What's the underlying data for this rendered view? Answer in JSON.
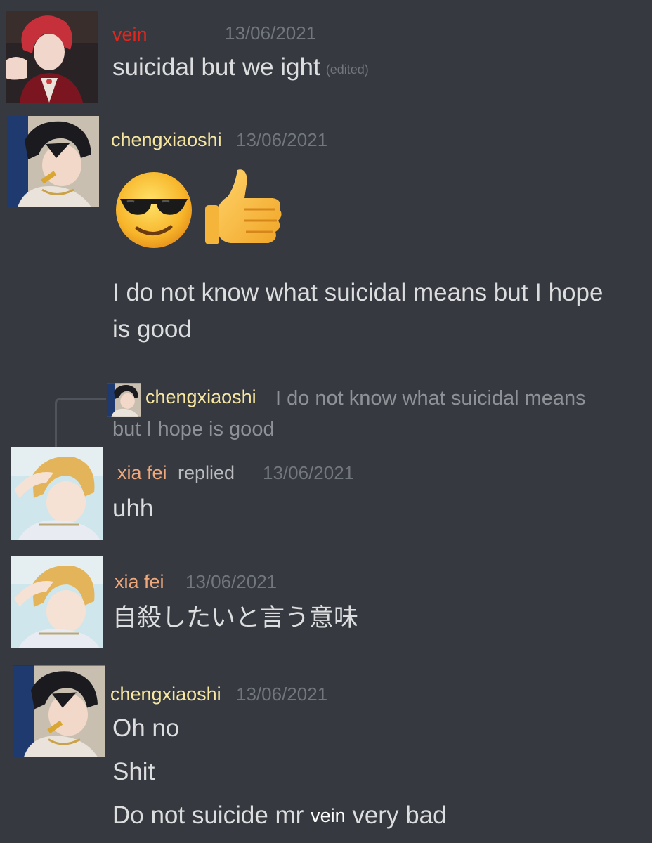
{
  "messages": [
    {
      "username": "vein",
      "username_color": "#e3261d",
      "timestamp": "13/06/2021",
      "lines": [
        "suicidal but we ight"
      ],
      "edited_label": "(edited)"
    },
    {
      "username": "chengxiaoshi",
      "username_color": "#f7e7a1",
      "timestamp": "13/06/2021",
      "emoji": [
        "smiling-face-with-sunglasses",
        "thumbs-up"
      ],
      "lines": [
        "I do not know what suicidal means but I hope",
        "is good"
      ]
    },
    {
      "reply_to": {
        "username": "chengxiaoshi",
        "text_line1": "I do not know what suicidal means",
        "text_line2": "but I hope is good"
      },
      "username": "xia fei",
      "username_color": "#f0a77a",
      "replied_label": "replied",
      "timestamp": "13/06/2021",
      "lines": [
        "uhh"
      ]
    },
    {
      "username": "xia fei",
      "username_color": "#f0a77a",
      "timestamp": "13/06/2021",
      "lines": [
        "自殺したいと言う意味"
      ]
    },
    {
      "username": "chengxiaoshi",
      "username_color": "#f7e7a1",
      "timestamp": "13/06/2021",
      "lines": [
        "Oh no",
        "Shit"
      ],
      "last_line": {
        "before": "Do not suicide mr",
        "mention": "vein",
        "after": "very bad"
      }
    }
  ],
  "colors": {
    "background": "#36393f",
    "text": "#dcddde",
    "muted": "#72767d"
  }
}
